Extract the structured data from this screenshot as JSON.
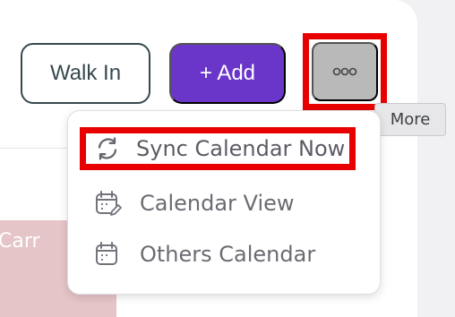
{
  "toolbar": {
    "walk_in_label": "Walk In",
    "add_label": "+ Add",
    "more_icon": "ellipsis-icon",
    "tooltip": "More"
  },
  "menu": {
    "items": [
      {
        "label": "Sync Calendar Now",
        "icon": "refresh-icon"
      },
      {
        "label": "Calendar View",
        "icon": "calendar-edit-icon"
      },
      {
        "label": "Others Calendar",
        "icon": "calendar-icon"
      }
    ]
  },
  "calendar": {
    "event_label": "Carr"
  },
  "colors": {
    "add_button": "#6a35c9",
    "highlight": "#e80000",
    "event": "#e5c5c7",
    "more_button": "#b9b9b9"
  }
}
